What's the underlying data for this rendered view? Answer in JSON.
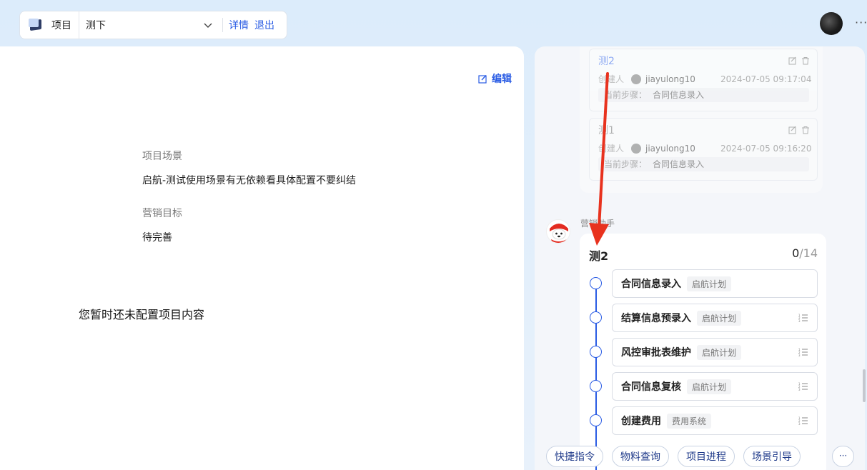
{
  "topbar": {
    "project_label": "项目",
    "project_value": "测下",
    "detail_link": "详情",
    "exit_link": "退出"
  },
  "main": {
    "edit_label": "编辑",
    "scene_label": "项目场景",
    "scene_value": "启航-测试使用场景有无依赖看具体配置不要纠结",
    "target_label": "营销目标",
    "target_value": "待完善",
    "empty_message": "您暂时还未配置项目内容"
  },
  "history": [
    {
      "title": "测2",
      "creator_label": "创建人",
      "creator": "jiayulong10",
      "time": "2024-07-05 09:17:04",
      "step_label": "当前步骤：",
      "step_value": "合同信息录入"
    },
    {
      "title": "测1",
      "creator_label": "创建人",
      "creator": "jiayulong10",
      "time": "2024-07-05 09:16:20",
      "step_label": "当前步骤：",
      "step_value": "合同信息录入"
    }
  ],
  "assistant": {
    "name": "营销助手"
  },
  "plan": {
    "title": "测2",
    "done": "0",
    "total": "/14",
    "steps": [
      {
        "name": "合同信息录入",
        "tag": "启航计划"
      },
      {
        "name": "结算信息预录入",
        "tag": "启航计划"
      },
      {
        "name": "风控审批表维护",
        "tag": "启航计划"
      },
      {
        "name": "合同信息复核",
        "tag": "启航计划"
      },
      {
        "name": "创建费用",
        "tag": "费用系统"
      }
    ]
  },
  "quick_actions": [
    "快捷指令",
    "物料查询",
    "项目进程",
    "场景引导"
  ],
  "quick_more": "···",
  "top_more": "···",
  "colors": {
    "accent": "#2a5ce4",
    "annotation_arrow": "#e8321e"
  }
}
